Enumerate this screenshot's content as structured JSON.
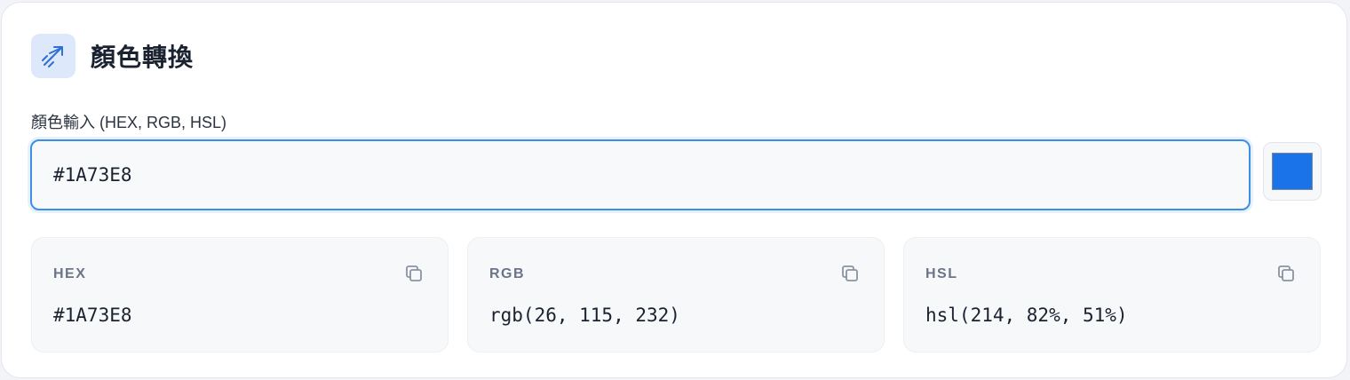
{
  "header": {
    "title": "顏色轉換",
    "icon": "diagonal-arrow-icon"
  },
  "input": {
    "label": "顏色輸入 (HEX, RGB, HSL)",
    "value": "#1A73E8"
  },
  "swatch": {
    "color": "#1A73E8"
  },
  "outputs": [
    {
      "label": "HEX",
      "value": "#1A73E8",
      "icon": "copy-icon"
    },
    {
      "label": "RGB",
      "value": "rgb(26, 115, 232)",
      "icon": "copy-icon"
    },
    {
      "label": "HSL",
      "value": "hsl(214, 82%, 51%)",
      "icon": "copy-icon"
    }
  ],
  "colors": {
    "accent": "#3d8ee6",
    "icon_bg": "#dde9fb",
    "icon_fg": "#2f6fd6"
  }
}
